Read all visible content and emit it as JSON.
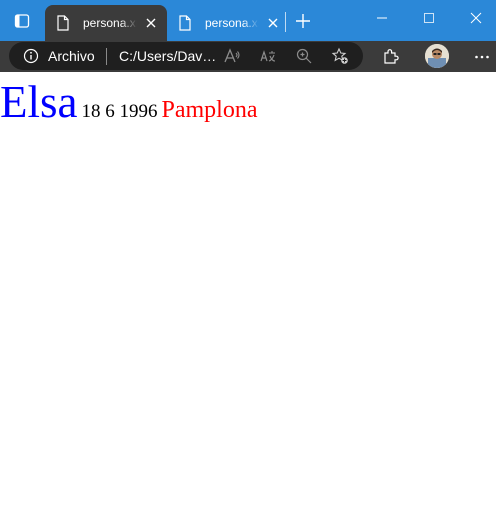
{
  "window": {
    "tabs": [
      {
        "title": "persona.xml",
        "active": true
      },
      {
        "title": "persona.xsl",
        "active": false
      }
    ]
  },
  "toolbar": {
    "site_info_label": "Archivo",
    "url": "C:/Users/David/persona.xml"
  },
  "page": {
    "nombre": "Elsa",
    "fecha": "18 6 1996",
    "ciudad": "Pamplona"
  },
  "colors": {
    "titlebar": "#2b88d8",
    "toolbar": "#3b3b3b",
    "nombre": "#0000ff",
    "ciudad": "#ff0000"
  }
}
